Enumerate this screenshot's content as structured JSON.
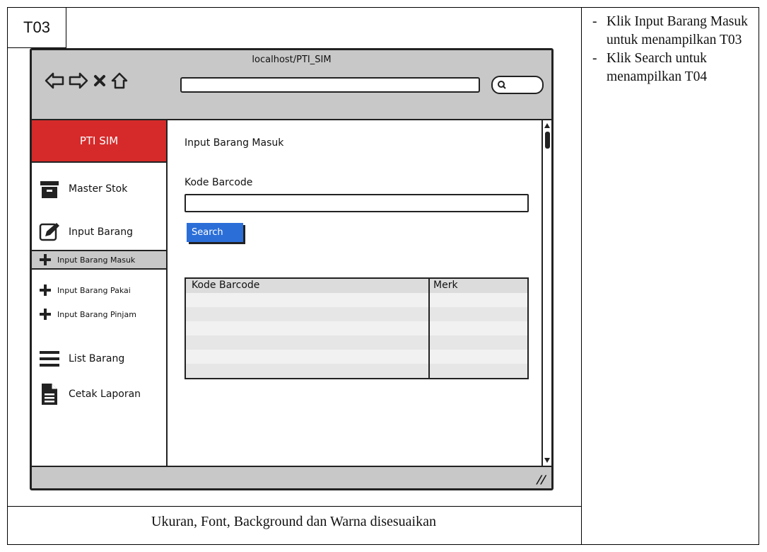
{
  "screen_id": "T03",
  "caption": "Ukuran, Font, Background dan Warna disesuaikan",
  "notes": [
    "Klik Input Barang Masuk untuk menampilkan T03",
    "Klik Search untuk menampilkan T04"
  ],
  "browser": {
    "url": "localhost/PTI_SIM",
    "nav_icons": [
      "back-arrow-icon",
      "forward-arrow-icon",
      "close-x-icon",
      "home-icon"
    ],
    "search_icon": "search-icon"
  },
  "sidebar": {
    "brand": "PTI SIM",
    "brand_color": "#d62a2a",
    "items": [
      {
        "label": "Master Stok",
        "icon": "archive-box-icon"
      },
      {
        "label": "Input Barang",
        "icon": "edit-pencil-icon"
      },
      {
        "label": "Input Barang Masuk",
        "icon": "plus-icon",
        "active": true
      },
      {
        "label": "Input Barang Pakai",
        "icon": "plus-icon"
      },
      {
        "label": "Input Barang Pinjam",
        "icon": "plus-icon"
      },
      {
        "label": "List Barang",
        "icon": "hamburger-list-icon"
      },
      {
        "label": "Cetak Laporan",
        "icon": "document-icon"
      }
    ]
  },
  "main": {
    "title": "Input Barang Masuk",
    "field_label": "Kode Barcode",
    "field_value": "",
    "search_button": "Search",
    "button_color": "#2b6ed8",
    "table": {
      "columns": [
        "Kode Barcode",
        "Merk"
      ],
      "rows": []
    }
  }
}
